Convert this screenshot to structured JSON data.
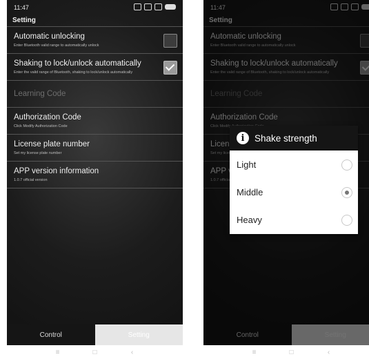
{
  "status": {
    "time": "11:47"
  },
  "header": {
    "title": "Setting"
  },
  "settings": [
    {
      "title": "Automatic unlocking",
      "sub": "Enter Bluetooth valid range to automatically unlock",
      "checked": false
    },
    {
      "title": "Shaking to lock/unlock automatically",
      "sub": "Enter the valid range of Bluetooth, shaking to lock/unlock automatically",
      "checked": true
    },
    {
      "title": "Learning Code",
      "sub": ""
    },
    {
      "title": "Authorization Code",
      "sub": "Click Modify Authorization Code"
    },
    {
      "title": "License plate number",
      "sub": "Set my license plate number"
    },
    {
      "title": "APP version information",
      "sub": "1.0.7 official version"
    }
  ],
  "tabs": {
    "control": "Control",
    "setting": "Setting"
  },
  "dialog": {
    "title": "Shake strength",
    "options": [
      "Light",
      "Middle",
      "Heavy"
    ],
    "selected": "Middle"
  },
  "navbar": {
    "menu": "≡",
    "home": "□",
    "back": "‹"
  }
}
